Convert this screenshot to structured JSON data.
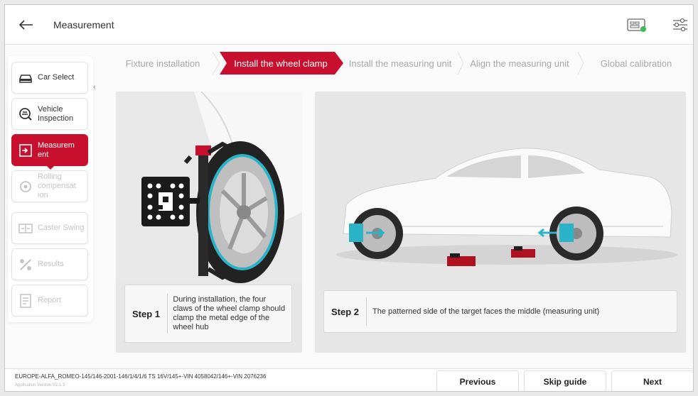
{
  "header": {
    "title": "Measurement",
    "back_icon": "back-arrow-icon",
    "icons": [
      "vehicle-info-icon",
      "settings-sliders-icon"
    ]
  },
  "sidebar": {
    "items": [
      {
        "label": "Car Select",
        "icon": "car-icon",
        "state": "normal"
      },
      {
        "label": "Vehicle Inspection",
        "icon": "inspection-icon",
        "state": "normal"
      },
      {
        "label": "Measurem ent",
        "icon": "measurement-icon",
        "state": "active"
      },
      {
        "label": "Rolling compensat ion",
        "icon": "wheel-icon",
        "state": "disabled"
      },
      {
        "label": "Caster Swing",
        "icon": "caster-icon",
        "state": "disabled"
      },
      {
        "label": "Results",
        "icon": "results-icon",
        "state": "disabled"
      },
      {
        "label": "Report",
        "icon": "report-icon",
        "state": "disabled"
      }
    ]
  },
  "steps": [
    {
      "label": "Fixture installation",
      "active": false
    },
    {
      "label": "Install the wheel clamp",
      "active": true
    },
    {
      "label": "Install the measuring unit",
      "active": false
    },
    {
      "label": "Align the measuring unit",
      "active": false
    },
    {
      "label": "Global calibration",
      "active": false
    }
  ],
  "panels": [
    {
      "step": "Step 1",
      "text": "During installation, the four claws of the wheel clamp should clamp the metal edge of the wheel hub"
    },
    {
      "step": "Step 2",
      "text": "The patterned side of the target faces the middle (measuring unit)"
    }
  ],
  "footer": {
    "vehicle": "EUROPE-ALFA_ROMEO-145/146-2001-146/1/4/1/6 TS 16V/145+-VIN 4058042/146+-VIN 2076236",
    "version": "Application Version:V2.1.3",
    "previous": "Previous",
    "skip": "Skip guide",
    "next": "Next"
  },
  "colors": {
    "accent": "#c8102e",
    "target_blue": "#2ab3c6",
    "panel_bg": "#e6e6e6"
  }
}
